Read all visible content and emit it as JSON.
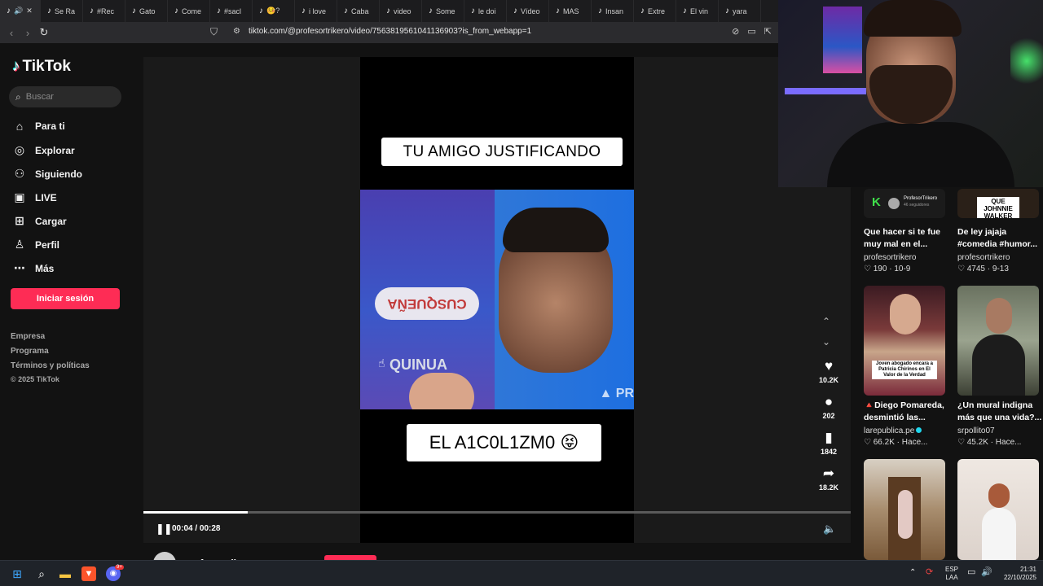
{
  "browser": {
    "tabs": [
      {
        "label": ""
      },
      {
        "label": "Se Ra"
      },
      {
        "label": "#Rec"
      },
      {
        "label": "Gato"
      },
      {
        "label": "Come"
      },
      {
        "label": "#sacl"
      },
      {
        "label": "🤒?"
      },
      {
        "label": "i love"
      },
      {
        "label": "Caba"
      },
      {
        "label": "video"
      },
      {
        "label": "Some"
      },
      {
        "label": "le doi"
      },
      {
        "label": "Vídeo"
      },
      {
        "label": "MAS"
      },
      {
        "label": "Insan"
      },
      {
        "label": "Extre"
      },
      {
        "label": "El vin"
      },
      {
        "label": "yara"
      }
    ],
    "url": "tiktok.com/@profesortrikero/video/7563819561041136903?is_from_webapp=1"
  },
  "sidebar": {
    "logo": "TikTok",
    "search_placeholder": "Buscar",
    "items": [
      {
        "label": "Para ti",
        "icon": "home-icon"
      },
      {
        "label": "Explorar",
        "icon": "compass-icon"
      },
      {
        "label": "Siguiendo",
        "icon": "following-icon"
      },
      {
        "label": "LIVE",
        "icon": "live-icon"
      },
      {
        "label": "Cargar",
        "icon": "upload-icon"
      },
      {
        "label": "Perfil",
        "icon": "profile-icon"
      },
      {
        "label": "Más",
        "icon": "more-icon"
      }
    ],
    "login_label": "Iniciar sesión",
    "footer": [
      "Empresa",
      "Programa",
      "Términos y políticas"
    ],
    "copyright": "© 2025 TikTok"
  },
  "video": {
    "caption_top": "TU AMIGO JUSTIFICANDO",
    "caption_bottom": "EL A1C0L1ZM0 😝",
    "bottle_brand": "CUSQUEÑA",
    "bottle_sub": "QUINUA",
    "watermark": "PR",
    "time": "00:04 / 00:28",
    "progress_fraction": 0.148
  },
  "actions": {
    "likes": "10.2K",
    "comments": "202",
    "saves": "1842",
    "shares": "18.2K"
  },
  "author": {
    "name": "profesortrikero"
  },
  "recommendations": [
    {
      "title1": "Que hacer si te fue",
      "title2": "muy mal en el...",
      "author": "profesortrikero",
      "likes": "190",
      "date": "10-9",
      "thumb_label": "ProfesorTrikero",
      "thumb_sub": "46 seguidores"
    },
    {
      "title1": "De ley jajaja",
      "title2": "#comedia #humor...",
      "author": "profesortrikero",
      "likes": "4745",
      "date": "9-13",
      "thumb_label": "QUE JOHNNIE WALKER"
    },
    {
      "title1": "🔺Diego Pomareda,",
      "title2": "desmintió las...",
      "author": "larepublica.pe",
      "likes": "66.2K",
      "date": "Hace...",
      "thumb_label": "Joven abogado encara a Patricia Chirinos en El Valor de la Verdad"
    },
    {
      "title1": "¿Un mural indigna",
      "title2": "más que una vida?...",
      "author": "srpollito07",
      "likes": "45.2K",
      "date": "Hace..."
    },
    {
      "title1": "",
      "title2": "",
      "author": "",
      "likes": "",
      "date": ""
    },
    {
      "title1": "",
      "title2": "",
      "author": "",
      "likes": "",
      "date": ""
    }
  ],
  "taskbar": {
    "lang1": "ESP",
    "lang2": "LAA",
    "time": "21:31",
    "date": "22/10/2025",
    "discord_badge": "9+"
  }
}
